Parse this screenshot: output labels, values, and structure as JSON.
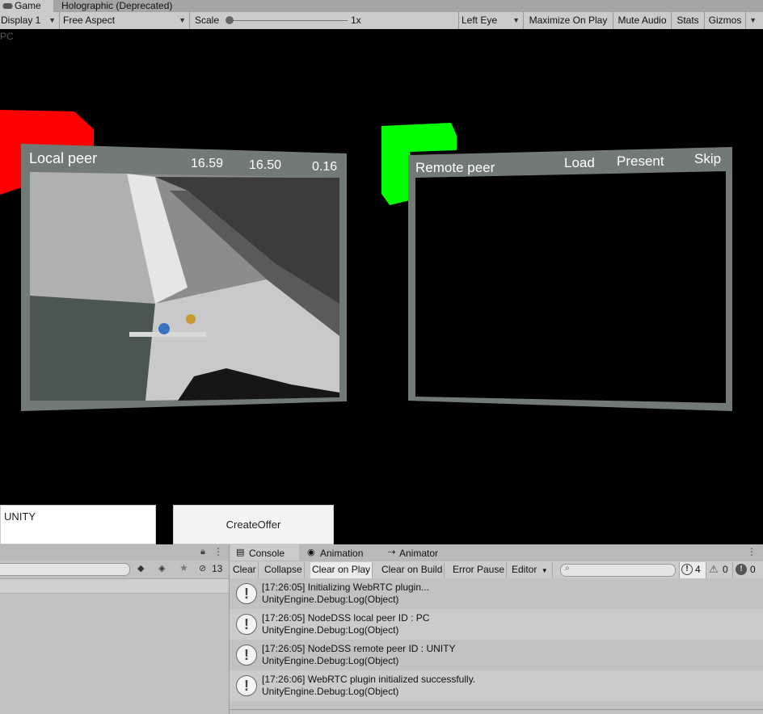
{
  "tabs": {
    "game": "Game",
    "holographic": "Holographic (Deprecated)"
  },
  "toolbar": {
    "display": "Display 1",
    "aspect": "Free Aspect",
    "scale_label": "Scale",
    "scale_value": "1x",
    "eye": "Left Eye",
    "maximize": "Maximize On Play",
    "mute": "Mute Audio",
    "stats": "Stats",
    "gizmos": "Gizmos"
  },
  "scene": {
    "corner_label": "PC",
    "local": {
      "title": "Local peer",
      "v1": "16.59",
      "v2": "16.50",
      "v3": "0.16"
    },
    "remote": {
      "title": "Remote peer",
      "load": "Load",
      "present": "Present",
      "skip": "Skip"
    },
    "peer_field": "UNITY",
    "create_offer": "CreateOffer"
  },
  "hierarchy": {
    "count": "13"
  },
  "console": {
    "tabs": [
      "Console",
      "Animation",
      "Animator"
    ],
    "buttons": [
      "Clear",
      "Collapse",
      "Clear on Play",
      "Clear on Build",
      "Error Pause",
      "Editor"
    ],
    "search_placeholder": "",
    "counts": {
      "warn_msgs": "4",
      "warnings": "0",
      "errors": "0"
    },
    "logs": [
      {
        "line1": "[17:26:05] Initializing WebRTC plugin...",
        "line2": "UnityEngine.Debug:Log(Object)"
      },
      {
        "line1": "[17:26:05] NodeDSS local peer ID : PC",
        "line2": "UnityEngine.Debug:Log(Object)"
      },
      {
        "line1": "[17:26:05] NodeDSS remote peer ID : UNITY",
        "line2": "UnityEngine.Debug:Log(Object)"
      },
      {
        "line1": "[17:26:06] WebRTC plugin initialized successfully.",
        "line2": "UnityEngine.Debug:Log(Object)"
      }
    ]
  },
  "colors": {
    "cube_red": "#ff0000",
    "cube_green": "#00ff00",
    "frame": "#727a77"
  }
}
